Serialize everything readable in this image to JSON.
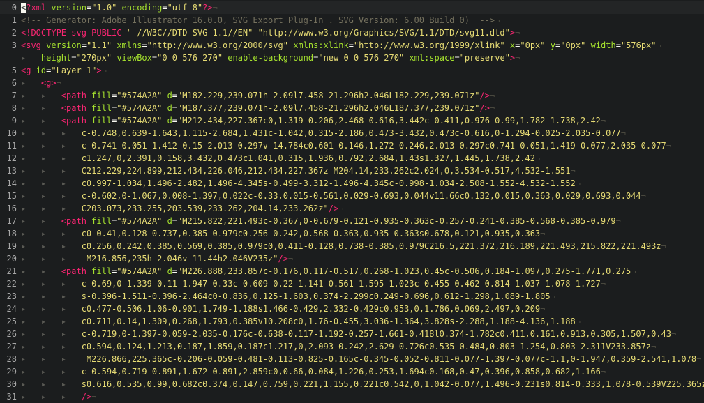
{
  "editor": {
    "lines": [
      {
        "n": "0",
        "seg": [
          [
            "cursor",
            "<"
          ],
          [
            "t-pi",
            "?xml"
          ],
          [
            "t-punct",
            " "
          ],
          [
            "t-attr",
            "version"
          ],
          [
            "t-punct",
            "="
          ],
          [
            "t-str",
            "\"1.0\""
          ],
          [
            "t-punct",
            " "
          ],
          [
            "t-attr",
            "encoding"
          ],
          [
            "t-punct",
            "="
          ],
          [
            "t-str",
            "\"utf-8\""
          ],
          [
            "t-pi",
            "?>"
          ],
          [
            "t-eol",
            "¬"
          ]
        ]
      },
      {
        "n": "1",
        "seg": [
          [
            "t-comment",
            "<!-- Generator: Adobe Illustrator 16.0.0, SVG Export Plug-In . SVG Version: 6.00 Build 0)  -->"
          ],
          [
            "t-eol",
            "¬"
          ]
        ]
      },
      {
        "n": "2",
        "seg": [
          [
            "t-tag",
            "<!DOCTYPE svg PUBLIC "
          ],
          [
            "t-str",
            "\"-//W3C//DTD SVG 1.1//EN\""
          ],
          [
            "t-tag",
            " "
          ],
          [
            "t-str",
            "\"http://www.w3.org/Graphics/SVG/1.1/DTD/svg11.dtd\""
          ],
          [
            "t-tag",
            ">"
          ],
          [
            "t-eol",
            "¬"
          ]
        ]
      },
      {
        "n": "3",
        "seg": [
          [
            "t-tag",
            "<svg"
          ],
          [
            "t-punct",
            " "
          ],
          [
            "t-attr",
            "version"
          ],
          [
            "t-punct",
            "="
          ],
          [
            "t-str",
            "\"1.1\""
          ],
          [
            "t-punct",
            " "
          ],
          [
            "t-attr",
            "xmlns"
          ],
          [
            "t-punct",
            "="
          ],
          [
            "t-str",
            "\"http://www.w3.org/2000/svg\""
          ],
          [
            "t-punct",
            " "
          ],
          [
            "t-attr",
            "xmlns:xlink"
          ],
          [
            "t-punct",
            "="
          ],
          [
            "t-str",
            "\"http://www.w3.org/1999/xlink\""
          ],
          [
            "t-punct",
            " "
          ],
          [
            "t-attr",
            "x"
          ],
          [
            "t-punct",
            "="
          ],
          [
            "t-str",
            "\"0px\""
          ],
          [
            "t-punct",
            " "
          ],
          [
            "t-attr",
            "y"
          ],
          [
            "t-punct",
            "="
          ],
          [
            "t-str",
            "\"0px\""
          ],
          [
            "t-punct",
            " "
          ],
          [
            "t-attr",
            "width"
          ],
          [
            "t-punct",
            "="
          ],
          [
            "t-str",
            "\"576px\""
          ],
          [
            "t-eol",
            "¬"
          ]
        ]
      },
      {
        "n": "",
        "seg": [
          [
            "t-indent",
            "▸   "
          ],
          [
            "t-attr",
            "height"
          ],
          [
            "t-punct",
            "="
          ],
          [
            "t-str",
            "\"270px\""
          ],
          [
            "t-punct",
            " "
          ],
          [
            "t-attr",
            "viewBox"
          ],
          [
            "t-punct",
            "="
          ],
          [
            "t-str",
            "\"0 0 576 270\""
          ],
          [
            "t-punct",
            " "
          ],
          [
            "t-attr",
            "enable-background"
          ],
          [
            "t-punct",
            "="
          ],
          [
            "t-str",
            "\"new 0 0 576 270\""
          ],
          [
            "t-punct",
            " "
          ],
          [
            "t-attr",
            "xml:space"
          ],
          [
            "t-punct",
            "="
          ],
          [
            "t-str",
            "\"preserve\""
          ],
          [
            "t-tag",
            ">"
          ],
          [
            "t-eol",
            "¬"
          ]
        ]
      },
      {
        "n": "5",
        "seg": [
          [
            "t-tag",
            "<g"
          ],
          [
            "t-punct",
            " "
          ],
          [
            "t-attr",
            "id"
          ],
          [
            "t-punct",
            "="
          ],
          [
            "t-str",
            "\"Layer_1\""
          ],
          [
            "t-tag",
            ">"
          ],
          [
            "t-eol",
            "¬"
          ]
        ]
      },
      {
        "n": "6",
        "seg": [
          [
            "t-indent",
            "▸   "
          ],
          [
            "t-tag",
            "<g>"
          ],
          [
            "t-eol",
            "¬"
          ]
        ]
      },
      {
        "n": "7",
        "seg": [
          [
            "t-indent",
            "▸   ▸   "
          ],
          [
            "t-tag",
            "<path"
          ],
          [
            "t-punct",
            " "
          ],
          [
            "t-attr",
            "fill"
          ],
          [
            "t-punct",
            "="
          ],
          [
            "t-str",
            "\"#574A2A\""
          ],
          [
            "t-punct",
            " "
          ],
          [
            "t-attr",
            "d"
          ],
          [
            "t-punct",
            "="
          ],
          [
            "t-str",
            "\"M182.229,239.071h-2.09l7.458-21.296h2.046L182.229,239.071z\""
          ],
          [
            "t-tag",
            "/>"
          ],
          [
            "t-eol",
            "¬"
          ]
        ]
      },
      {
        "n": "8",
        "seg": [
          [
            "t-indent",
            "▸   ▸   "
          ],
          [
            "t-tag",
            "<path"
          ],
          [
            "t-punct",
            " "
          ],
          [
            "t-attr",
            "fill"
          ],
          [
            "t-punct",
            "="
          ],
          [
            "t-str",
            "\"#574A2A\""
          ],
          [
            "t-punct",
            " "
          ],
          [
            "t-attr",
            "d"
          ],
          [
            "t-punct",
            "="
          ],
          [
            "t-str",
            "\"M187.377,239.071h-2.09l7.458-21.296h2.046L187.377,239.071z\""
          ],
          [
            "t-tag",
            "/>"
          ],
          [
            "t-eol",
            "¬"
          ]
        ]
      },
      {
        "n": "9",
        "seg": [
          [
            "t-indent",
            "▸   ▸   "
          ],
          [
            "t-tag",
            "<path"
          ],
          [
            "t-punct",
            " "
          ],
          [
            "t-attr",
            "fill"
          ],
          [
            "t-punct",
            "="
          ],
          [
            "t-str",
            "\"#574A2A\""
          ],
          [
            "t-punct",
            " "
          ],
          [
            "t-attr",
            "d"
          ],
          [
            "t-punct",
            "="
          ],
          [
            "t-str",
            "\"M212.434,227.367c0,1.319-0.206,2.468-0.616,3.442c-0.411,0.976-0.99,1.782-1.738,2.42"
          ],
          [
            "t-eol",
            "¬"
          ]
        ]
      },
      {
        "n": "10",
        "seg": [
          [
            "t-indent",
            "▸   ▸   ▸   "
          ],
          [
            "t-str",
            "c-0.748,0.639-1.643,1.115-2.684,1.431c-1.042,0.315-2.186,0.473-3.432,0.473c-0.616,0-1.294-0.025-2.035-0.077"
          ],
          [
            "t-eol",
            "¬"
          ]
        ]
      },
      {
        "n": "11",
        "seg": [
          [
            "t-indent",
            "▸   ▸   ▸   "
          ],
          [
            "t-str",
            "c-0.741-0.051-1.412-0.15-2.013-0.297v-14.784c0.601-0.146,1.272-0.246,2.013-0.297c0.741-0.051,1.419-0.077,2.035-0.077"
          ],
          [
            "t-eol",
            "¬"
          ]
        ]
      },
      {
        "n": "12",
        "seg": [
          [
            "t-indent",
            "▸   ▸   ▸   "
          ],
          [
            "t-str",
            "c1.247,0,2.391,0.158,3.432,0.473c1.041,0.315,1.936,0.792,2.684,1.43s1.327,1.445,1.738,2.42"
          ],
          [
            "t-eol",
            "¬"
          ]
        ]
      },
      {
        "n": "13",
        "seg": [
          [
            "t-indent",
            "▸   ▸   ▸   "
          ],
          [
            "t-str",
            "C212.229,224.899,212.434,226.046,212.434,227.367z M204.14,233.262c2.024,0,3.534-0.517,4.532-1.551"
          ],
          [
            "t-eol",
            "¬"
          ]
        ]
      },
      {
        "n": "14",
        "seg": [
          [
            "t-indent",
            "▸   ▸   ▸   "
          ],
          [
            "t-str",
            "c0.997-1.034,1.496-2.482,1.496-4.345s-0.499-3.312-1.496-4.345c-0.998-1.034-2.508-1.552-4.532-1.552"
          ],
          [
            "t-eol",
            "¬"
          ]
        ]
      },
      {
        "n": "15",
        "seg": [
          [
            "t-indent",
            "▸   ▸   ▸   "
          ],
          [
            "t-str",
            "c-0.602,0-1.067,0.008-1.397,0.022c-0.33,0.015-0.561,0.029-0.693,0.044v11.66c0.132,0.015,0.363,0.029,0.693,0.044"
          ],
          [
            "t-eol",
            "¬"
          ]
        ]
      },
      {
        "n": "16",
        "seg": [
          [
            "t-indent",
            "▸   ▸   ▸   "
          ],
          [
            "t-str",
            "C203.073,233.255,203.539,233.262,204.14,233.262z\""
          ],
          [
            "t-tag",
            "/>"
          ],
          [
            "t-eol",
            "¬"
          ]
        ]
      },
      {
        "n": "17",
        "seg": [
          [
            "t-indent",
            "▸   ▸   "
          ],
          [
            "t-tag",
            "<path"
          ],
          [
            "t-punct",
            " "
          ],
          [
            "t-attr",
            "fill"
          ],
          [
            "t-punct",
            "="
          ],
          [
            "t-str",
            "\"#574A2A\""
          ],
          [
            "t-punct",
            " "
          ],
          [
            "t-attr",
            "d"
          ],
          [
            "t-punct",
            "="
          ],
          [
            "t-str",
            "\"M215.822,221.493c-0.367,0-0.679-0.121-0.935-0.363c-0.257-0.241-0.385-0.568-0.385-0.979"
          ],
          [
            "t-eol",
            "¬"
          ]
        ]
      },
      {
        "n": "18",
        "seg": [
          [
            "t-indent",
            "▸   ▸   ▸   "
          ],
          [
            "t-str",
            "c0-0.41,0.128-0.737,0.385-0.979c0.256-0.242,0.568-0.363,0.935-0.363s0.678,0.121,0.935,0.363"
          ],
          [
            "t-eol",
            "¬"
          ]
        ]
      },
      {
        "n": "19",
        "seg": [
          [
            "t-indent",
            "▸   ▸   ▸   "
          ],
          [
            "t-str",
            "c0.256,0.242,0.385,0.569,0.385,0.979c0,0.411-0.128,0.738-0.385,0.979C216.5,221.372,216.189,221.493,215.822,221.493z"
          ],
          [
            "t-eol",
            "¬"
          ]
        ]
      },
      {
        "n": "20",
        "seg": [
          [
            "t-indent",
            "▸   ▸   ▸   "
          ],
          [
            "t-str",
            " M216.856,235h-2.046v-11.44h2.046V235z\""
          ],
          [
            "t-tag",
            "/>"
          ],
          [
            "t-eol",
            "¬"
          ]
        ]
      },
      {
        "n": "21",
        "seg": [
          [
            "t-indent",
            "▸   ▸   "
          ],
          [
            "t-tag",
            "<path"
          ],
          [
            "t-punct",
            " "
          ],
          [
            "t-attr",
            "fill"
          ],
          [
            "t-punct",
            "="
          ],
          [
            "t-str",
            "\"#574A2A\""
          ],
          [
            "t-punct",
            " "
          ],
          [
            "t-attr",
            "d"
          ],
          [
            "t-punct",
            "="
          ],
          [
            "t-str",
            "\"M226.888,233.857c-0.176,0.117-0.517,0.268-1.023,0.45c-0.506,0.184-1.097,0.275-1.771,0.275"
          ],
          [
            "t-eol",
            "¬"
          ]
        ]
      },
      {
        "n": "22",
        "seg": [
          [
            "t-indent",
            "▸   ▸   ▸   "
          ],
          [
            "t-str",
            "c-0.69,0-1.339-0.11-1.947-0.33c-0.609-0.22-1.141-0.561-1.595-1.023c-0.455-0.462-0.814-1.037-1.078-1.727"
          ],
          [
            "t-eol",
            "¬"
          ]
        ]
      },
      {
        "n": "23",
        "seg": [
          [
            "t-indent",
            "▸   ▸   ▸   "
          ],
          [
            "t-str",
            "s-0.396-1.511-0.396-2.464c0-0.836,0.125-1.603,0.374-2.299c0.249-0.696,0.612-1.298,1.089-1.805"
          ],
          [
            "t-eol",
            "¬"
          ]
        ]
      },
      {
        "n": "24",
        "seg": [
          [
            "t-indent",
            "▸   ▸   ▸   "
          ],
          [
            "t-str",
            "c0.477-0.506,1.06-0.901,1.749-1.188s1.466-0.429,2.332-0.429c0.953,0,1.786,0.069,2.497,0.209"
          ],
          [
            "t-eol",
            "¬"
          ]
        ]
      },
      {
        "n": "25",
        "seg": [
          [
            "t-indent",
            "▸   ▸   ▸   "
          ],
          [
            "t-str",
            "c0.711,0.14,1.309,0.268,1.793,0.385v10.208c0,1.76-0.455,3.036-1.364,3.828s-2.288,1.188-4.136,1.188"
          ],
          [
            "t-eol",
            "¬"
          ]
        ]
      },
      {
        "n": "26",
        "seg": [
          [
            "t-indent",
            "▸   ▸   ▸   "
          ],
          [
            "t-str",
            "c-0.719,0-1.397-0.059-2.035-0.176c-0.638-0.117-1.192-0.257-1.661-0.418l0.374-1.782c0.411,0.161,0.913,0.305,1.507,0.43"
          ],
          [
            "t-eol",
            "¬"
          ]
        ]
      },
      {
        "n": "27",
        "seg": [
          [
            "t-indent",
            "▸   ▸   ▸   "
          ],
          [
            "t-str",
            "c0.594,0.124,1.213,0.187,1.859,0.187c1.217,0,2.093-0.242,2.629-0.726c0.535-0.484,0.803-1.254,0.803-2.311V233.857z"
          ],
          [
            "t-eol",
            "¬"
          ]
        ]
      },
      {
        "n": "28",
        "seg": [
          [
            "t-indent",
            "▸   ▸   ▸   "
          ],
          [
            "t-str",
            " M226.866,225.365c-0.206-0.059-0.481-0.113-0.825-0.165c-0.345-0.052-0.811-0.077-1.397-0.077c-1.1,0-1.947,0.359-2.541,1.078"
          ],
          [
            "t-eol",
            "¬"
          ]
        ]
      },
      {
        "n": "29",
        "seg": [
          [
            "t-indent",
            "▸   ▸   ▸   "
          ],
          [
            "t-str",
            "c-0.594,0.719-0.891,1.672-0.891,2.859c0,0.66,0.084,1.226,0.253,1.694c0.168,0.47,0.396,0.858,0.682,1.166"
          ],
          [
            "t-eol",
            "¬"
          ]
        ]
      },
      {
        "n": "30",
        "seg": [
          [
            "t-indent",
            "▸   ▸   ▸   "
          ],
          [
            "t-str",
            "s0.616,0.535,0.99,0.682c0.374,0.147,0.759,0.221,1.155,0.221c0.542,0,1.042-0.077,1.496-0.231s0.814-0.333,1.078-0.539V225.365z\""
          ],
          [
            "t-eol",
            "¬"
          ]
        ]
      },
      {
        "n": "31",
        "seg": [
          [
            "t-indent",
            "▸   ▸   ▸   "
          ],
          [
            "t-tag",
            "/>"
          ],
          [
            "t-eol",
            "¬"
          ]
        ]
      }
    ]
  }
}
